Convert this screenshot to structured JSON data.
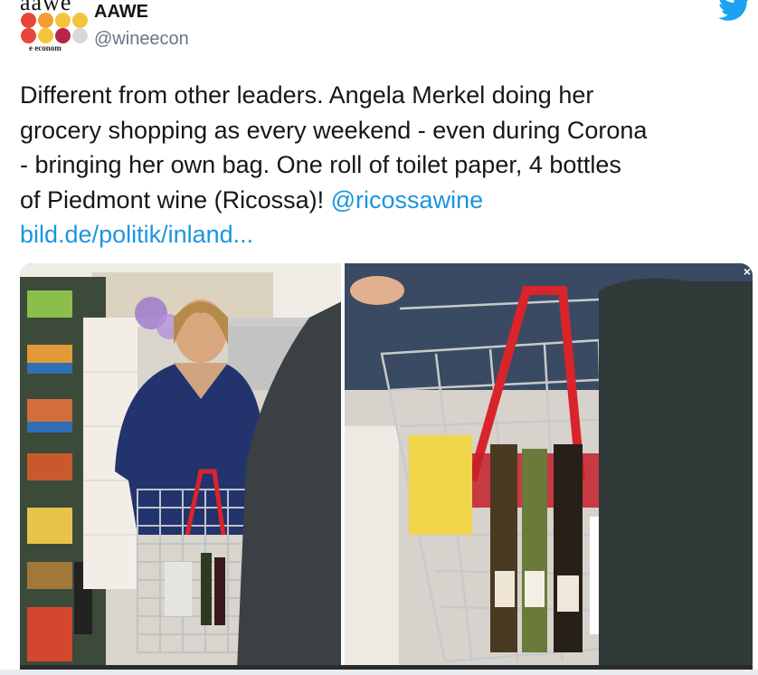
{
  "account": {
    "name": "AAWE",
    "handle": "@wineecon",
    "avatar_logo": "aawe",
    "avatar_subtitle": "e econom"
  },
  "tweet": {
    "lines": [
      "Different from other leaders. Angela Merkel doing her",
      "grocery shopping as every weekend - even during Corona",
      "- bringing her own bag. One roll of toilet paper, 4 bottles"
    ],
    "line4_text": "of Piedmont wine (Ricossa)! ",
    "mention": "@ricossawine",
    "link": "bild.de/politik/inland..."
  },
  "icons": {
    "brand": "twitter-bird-icon",
    "close": "close-icon"
  },
  "colors": {
    "link": "#1b95e0",
    "handle": "#657786",
    "twitter_blue": "#1da1f2",
    "logo_dots": [
      "#e8463c",
      "#f39c34",
      "#f5c43a",
      "#f5c43a",
      "#e8463c",
      "#f5c43a",
      "#b8234a",
      "#d8d8d8"
    ]
  },
  "media": {
    "close_symbol": "×",
    "description_label": "photo"
  }
}
